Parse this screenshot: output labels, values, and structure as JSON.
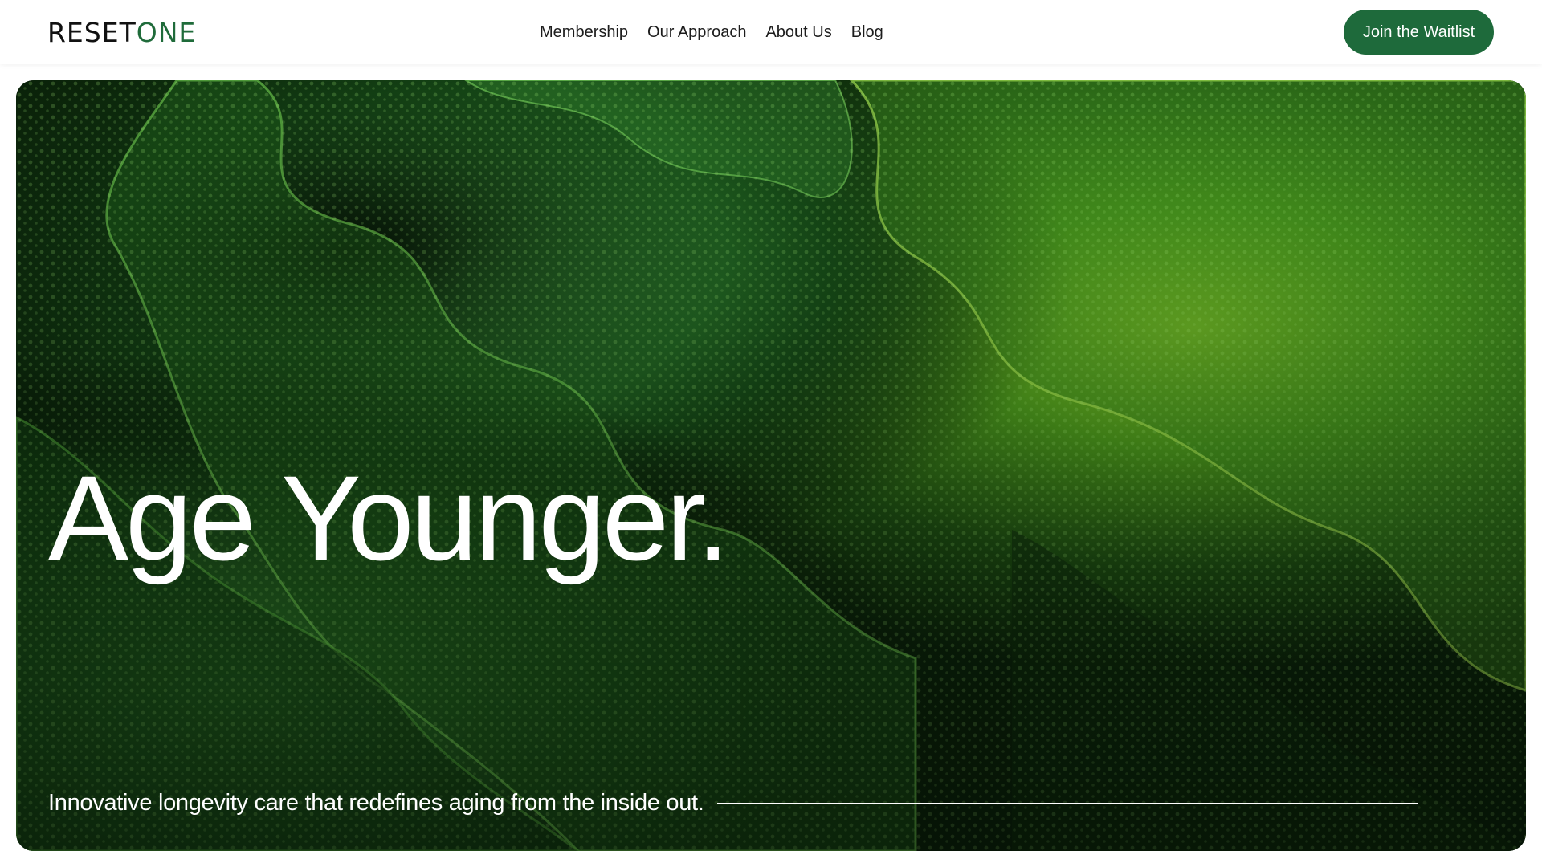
{
  "brand": {
    "name_part1": "RESET",
    "name_part2": "ONE",
    "accent_color": "#1e6a3b"
  },
  "nav": {
    "items": [
      {
        "label": "Membership"
      },
      {
        "label": "Our Approach"
      },
      {
        "label": "About Us"
      },
      {
        "label": "Blog"
      }
    ]
  },
  "header": {
    "cta_label": "Join the Waitlist"
  },
  "hero": {
    "headline": "Age Younger.",
    "tagline": "Innovative longevity care that redefines aging from the inside out.",
    "image": "green-cellular-macro-texture"
  }
}
